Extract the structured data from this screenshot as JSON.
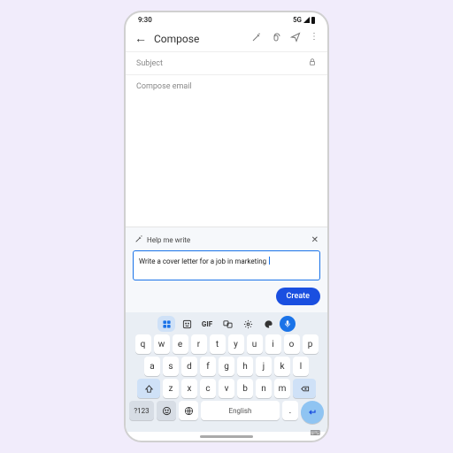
{
  "status": {
    "time": "9:30",
    "net": "5G"
  },
  "appbar": {
    "title": "Compose"
  },
  "subject": {
    "placeholder": "Subject"
  },
  "body": {
    "placeholder": "Compose email"
  },
  "panel": {
    "title": "Help me write",
    "prompt": "Write a cover letter for a job in marketing",
    "create": "Create"
  },
  "keyboard": {
    "gif": "GIF",
    "row1": [
      "q",
      "w",
      "e",
      "r",
      "t",
      "y",
      "u",
      "i",
      "o",
      "p"
    ],
    "row2": [
      "a",
      "s",
      "d",
      "f",
      "g",
      "h",
      "j",
      "k",
      "l"
    ],
    "row3": [
      "z",
      "x",
      "c",
      "v",
      "b",
      "n",
      "m"
    ],
    "sym": "?123",
    "space": "English",
    "dot": "."
  }
}
